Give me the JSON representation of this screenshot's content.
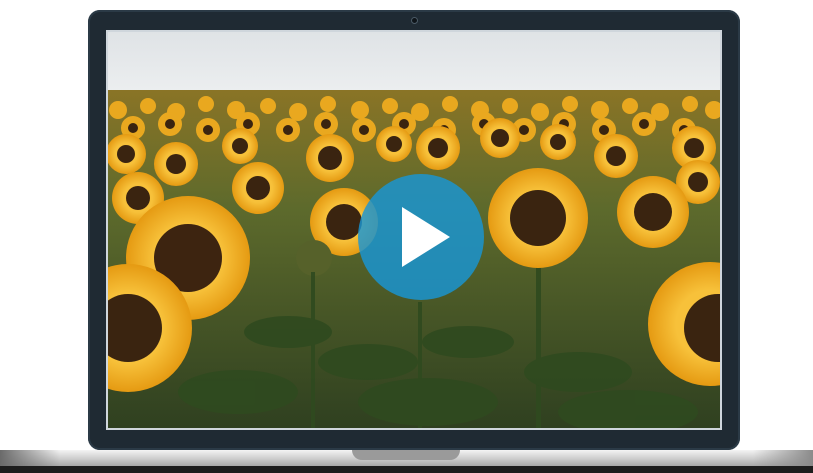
{
  "video": {
    "thumbnail": "sunflower field",
    "play_icon": "play-icon"
  },
  "colors": {
    "bezel": "#1f2a33",
    "play_button": "#1896d6",
    "sky": "#e9ecef",
    "sunflower_petal": "#f2b01e",
    "sunflower_center": "#3a2410",
    "foliage": "#3e5a26"
  }
}
